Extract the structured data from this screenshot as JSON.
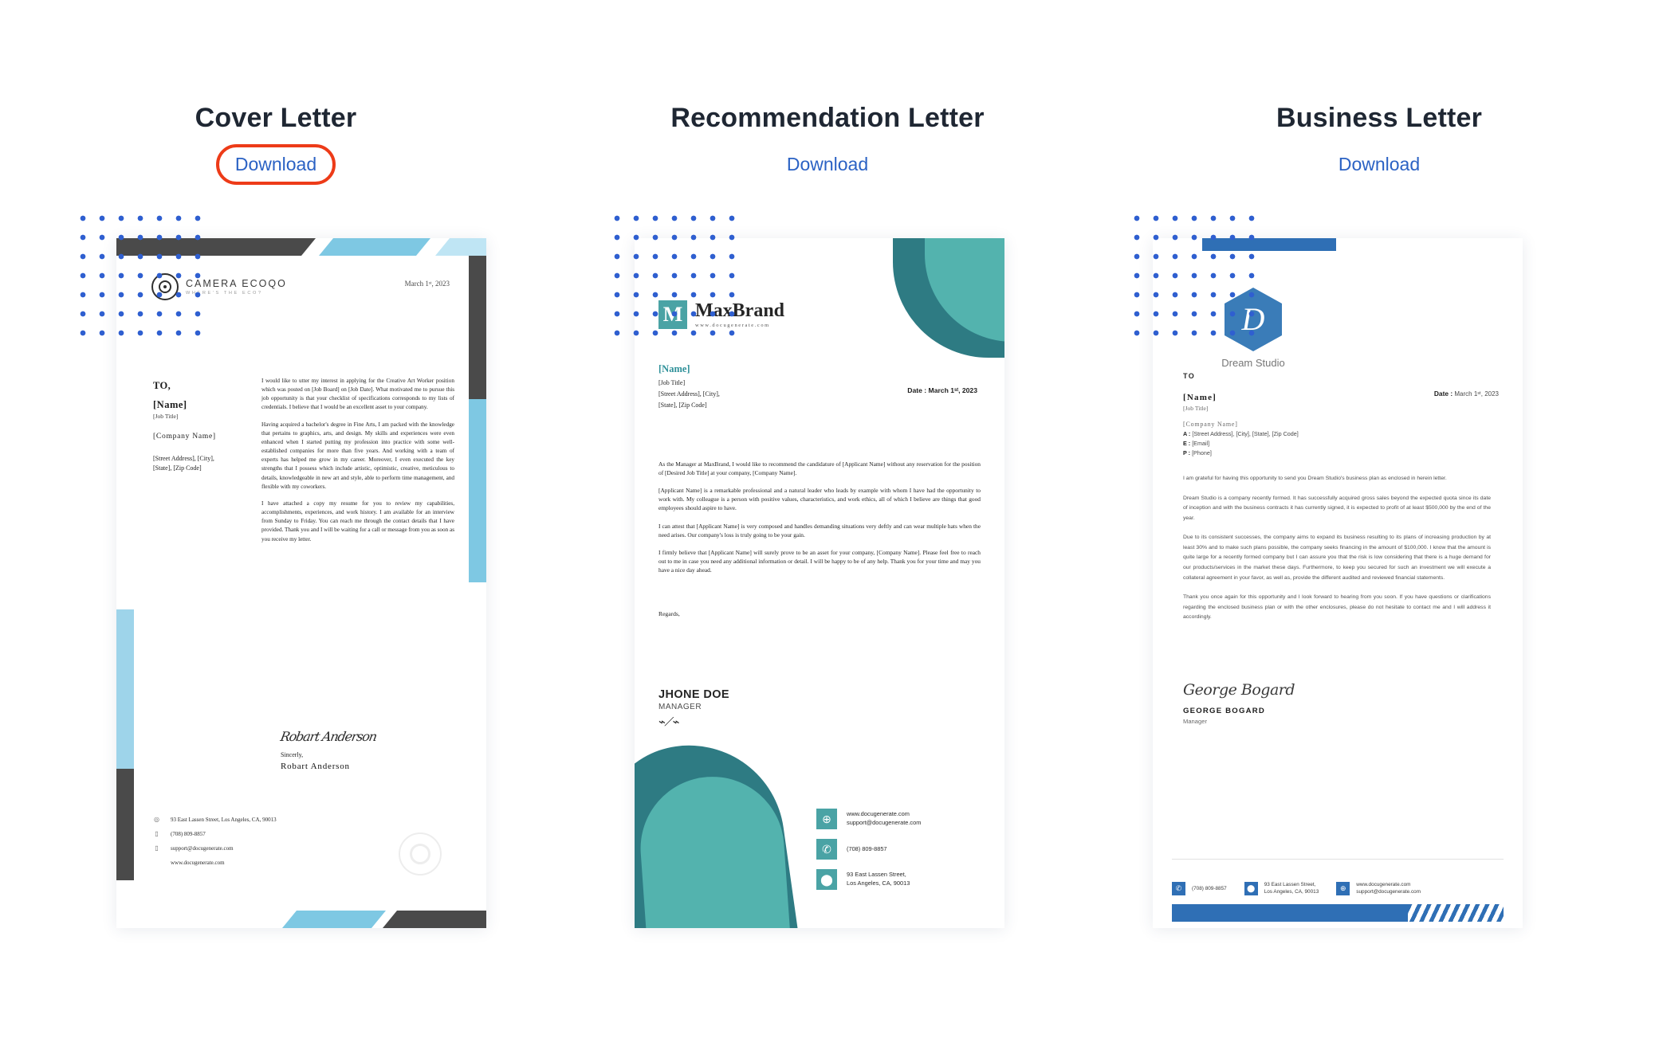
{
  "letters": [
    {
      "title": "Cover Letter",
      "download_label": "Download",
      "highlighted": true,
      "logo": {
        "name": "CAMERA ECOQO",
        "tagline": "WHERE'S THE ECO?"
      },
      "date": "March 1ˢᵗ, 2023",
      "recipient": {
        "to": "TO,",
        "name": "[Name]",
        "job_title": "[Job Title]",
        "company": "[Company Name]",
        "address_line1": "[Street Address], [City],",
        "address_line2": "[State], [Zip Code]"
      },
      "paragraphs": [
        "I would like to utter my interest in applying for the Creative Art Worker position which was posted on [Job Board] on [Job Date]. What motivated me to pursue this job opportunity is that your checklist of specifications corresponds to my lists of credentials. I believe that I would be an excellent asset to your company.",
        "Having acquired a bachelor's degree in Fine Arts, I am packed with the knowledge that pertains to graphics, arts, and design. My skills and experiences were even enhanced when I started putting my profession into practice with some well-established companies for more than five years. And working with a team of experts has helped me grow in my career. Moreover, I even executed the key strengths that I possess which include artistic, optimistic, creative, meticulous to details, knowledgeable in new art and style, able to perform time management, and flexible with my coworkers.",
        "I have attached a copy my resume for you to review my capabilities, accomplishments, experiences, and work history. I am available for an interview from Sunday to Friday. You can reach me through the contact details that I have provided. Thank you and I will be waiting for a call or message from you as soon as you receive my letter."
      ],
      "signature": {
        "script": "Robart Anderson",
        "closing": "Sincerly,",
        "name": "Robart Anderson"
      },
      "footer": {
        "address": "93 East Lassen Street, Los Angeles, CA, 90013",
        "phone": "(708) 809-8857",
        "email": "support@docugenerate.com",
        "website": "www.docugenerate.com"
      }
    },
    {
      "title": "Recommendation Letter",
      "download_label": "Download",
      "highlighted": false,
      "logo": {
        "mark": "M",
        "name": "MaxBrand",
        "url": "www.docugenerate.com"
      },
      "date_label": "Date : March 1ˢᵗ, 2023",
      "recipient": {
        "name": "[Name]",
        "job_title": "[Job Title]",
        "address_line1": "[Street Address], [City],",
        "address_line2": "[State], [Zip Code]"
      },
      "paragraphs": [
        "As the Manager at  MaxBrand, I would like to recommend the candidature of [Applicant Name] without any reservation for the position of [Desired Job Title] at your company, [Company Name].",
        "[Applicant Name] is a remarkable professional and a natural leader who leads by example with whom I have had the opportunity to work with. My colleague is a person with positive values, characteristics, and work ethics, all of which I believe are things that good employees should aspire to have.",
        "I can attest that [Applicant Name] is very composed and handles demanding situations very deftly and can wear multiple hats when the need arises. Our company's loss is truly going to be your gain.",
        "I firmly believe that [Applicant Name] will surely prove to be an asset for your company, [Company Name]. Please feel free to reach out to me in case you need any additional information or detail. I will be happy to be of any help. Thank you for your time and may you have a nice day ahead."
      ],
      "regards": "Regards,",
      "signature": {
        "name": "JHONE DOE",
        "role": "MANAGER"
      },
      "footer": {
        "website": "www.docugenerate.com",
        "email": "support@docugenerate.com",
        "phone": "(708) 809-8857",
        "address_line1": "93 East Lassen Street,",
        "address_line2": "Los Angeles, CA, 90013"
      }
    },
    {
      "title": "Business Letter",
      "download_label": "Download",
      "highlighted": false,
      "logo": {
        "mark": "D",
        "name": "Dream Studio"
      },
      "date_label": "Date :",
      "date": "March 1ˢᵗ, 2023",
      "recipient": {
        "to": "TO",
        "name": "[Name]",
        "job_title": "[Job Title]",
        "company": "[Company Name]",
        "address": "[Street Address], [City], [State], [Zip Code]",
        "address_key": "A :",
        "email": "[Email]",
        "email_key": "E :",
        "phone": "[Phone]",
        "phone_key": "P :"
      },
      "paragraphs": [
        "I am grateful for having this opportunity to send you Dream Studio's business plan as enclosed in herein letter.",
        "Dream Studio is a company recently formed. It has successfully acquired gross sales beyond the expected quota since its date of inception and with the business contracts it has currently signed, it is expected to profit of at least $500,000 by the end of the year.",
        "Due to its consistent successes, the company aims to expand its business resulting to its plans of increasing production by at least 30% and to make such plans possible, the company seeks financing in the amount of $100,000. I know that the amount is quite large for a recently formed company but I can assure you that the risk is low considering that there is a huge demand for our products/services in the market these days. Furthermore, to keep you secured for such an investment we will execute a collateral agreement in your favor, as well as, provide the different audited and reviewed financial statements.",
        "Thank you once again for this opportunity and I look forward to hearing from you soon. If you have questions or clarifications regarding the enclosed business plan or with the other enclosures, please do not hesitate to contact me and I will address it accordingly."
      ],
      "signature": {
        "script": "George Bogard",
        "name": "GEORGE BOGARD",
        "role": "Manager"
      },
      "footer": {
        "phone": "(708) 809-8857",
        "address_line1": "93 East Lassen Street,",
        "address_line2": "Los Angeles, CA, 90013",
        "website": "www.docugenerate.com",
        "email": "support@docugenerate.com"
      }
    }
  ],
  "colors": {
    "link": "#2b62c4",
    "highlight_ring": "#ed3b18",
    "dots": "#2f5fd0",
    "teal": "#4aa3a5",
    "blue": "#2f6fb5",
    "light_blue": "#7ec8e3",
    "dark": "#4a4a4a"
  },
  "icons": {
    "location": "⌖",
    "phone": "▯",
    "email": "✉",
    "globe": "🌐",
    "pin": "📍"
  }
}
